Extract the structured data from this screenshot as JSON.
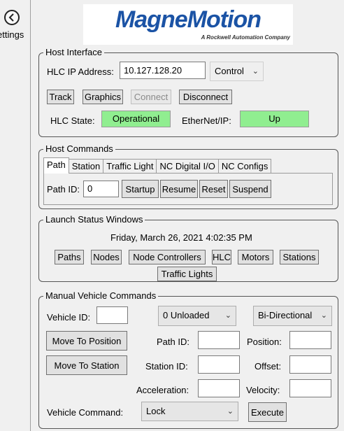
{
  "nav": {
    "settings_label": "ettings"
  },
  "logo": {
    "brand": "MagneMotion",
    "tagline": "A Rockwell Automation Company"
  },
  "host_interface": {
    "title": "Host Interface",
    "ip_label": "HLC IP Address:",
    "ip_value": "10.127.128.20",
    "mode_select": "Control",
    "buttons": {
      "track": "Track",
      "graphics": "Graphics",
      "connect": "Connect",
      "disconnect": "Disconnect"
    },
    "hlc_state_label": "HLC State:",
    "hlc_state_value": "Operational",
    "ethernet_label": "EtherNet/IP:",
    "ethernet_value": "Up",
    "status_color": "#90ee90"
  },
  "host_commands": {
    "title": "Host Commands",
    "tabs": [
      "Path",
      "Station",
      "Traffic Light",
      "NC Digital I/O",
      "NC Configs"
    ],
    "path_id_label": "Path ID:",
    "path_id_value": "0",
    "buttons": {
      "startup": "Startup",
      "resume": "Resume",
      "reset": "Reset",
      "suspend": "Suspend"
    }
  },
  "launch_status": {
    "title": "Launch Status Windows",
    "datetime": "Friday, March 26, 2021 4:02:35 PM",
    "buttons": [
      "Paths",
      "Nodes",
      "Node Controllers",
      "HLC",
      "Motors",
      "Stations",
      "Traffic Lights"
    ]
  },
  "manual_vehicle": {
    "title": "Manual Vehicle Commands",
    "vehicle_id_label": "Vehicle ID:",
    "vehicle_id_value": "",
    "load_select": "0 Unloaded",
    "direction_select": "Bi-Directional",
    "move_to_position": "Move To Position",
    "move_to_station": "Move To Station",
    "path_id_label": "Path ID:",
    "position_label": "Position:",
    "station_id_label": "Station ID:",
    "offset_label": "Offset:",
    "acceleration_label": "Acceleration:",
    "velocity_label": "Velocity:",
    "vehicle_command_label": "Vehicle Command:",
    "vehicle_command_select": "Lock",
    "execute": "Execute"
  }
}
